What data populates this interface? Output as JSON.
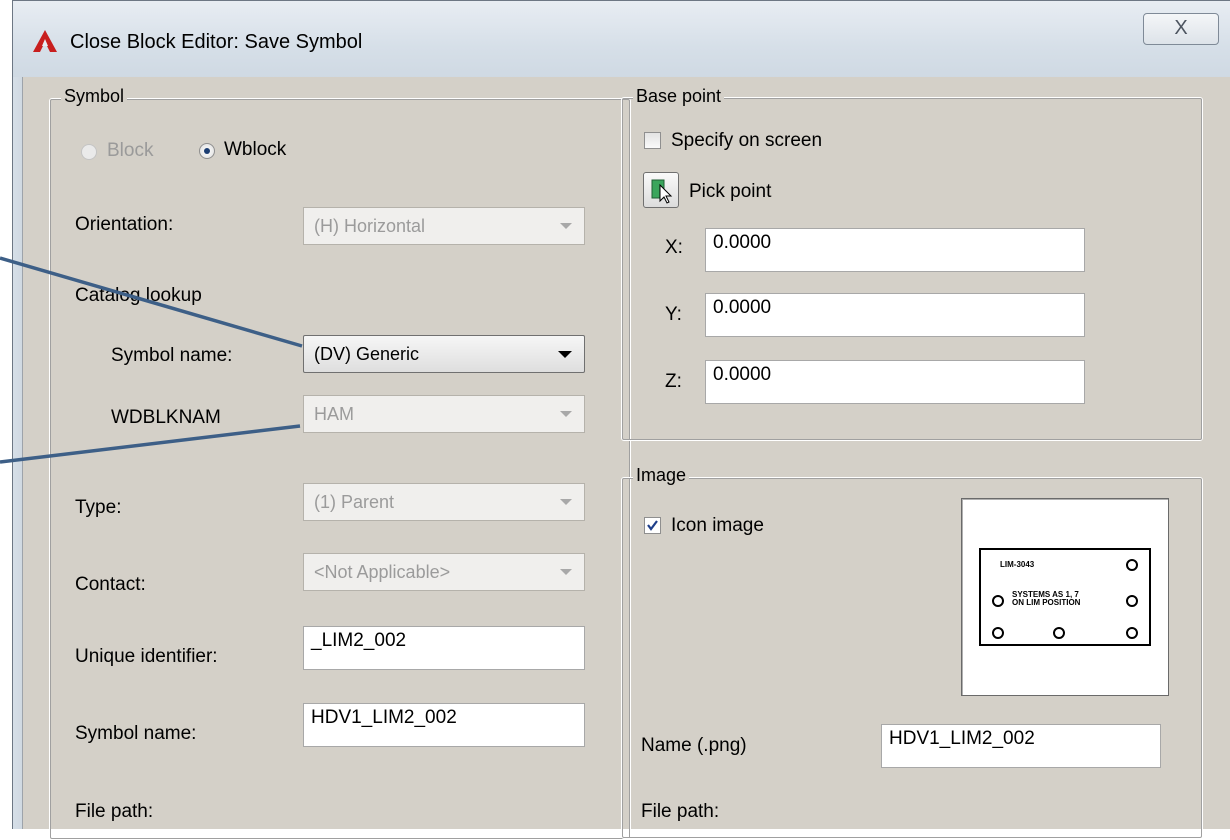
{
  "window": {
    "title": "Close Block Editor: Save Symbol",
    "close_glyph": "X"
  },
  "symbol_group": {
    "legend": "Symbol",
    "radio_block": "Block",
    "radio_wblock": "Wblock",
    "selected": "Wblock",
    "orientation_label": "Orientation:",
    "orientation_value": "(H) Horizontal",
    "catalog_lookup_label": "Catalog lookup",
    "symbol_name_combo_label": "Symbol name:",
    "symbol_name_combo_value": "(DV) Generic",
    "wdblknam_label": "WDBLKNAM",
    "wdblknam_value": "HAM",
    "type_label": "Type:",
    "type_value": "(1) Parent",
    "contact_label": "Contact:",
    "contact_value": "<Not Applicable>",
    "unique_id_label": "Unique identifier:",
    "unique_id_value": "_LIM2_002",
    "symbol_name_label": "Symbol name:",
    "symbol_name_value": "HDV1_LIM2_002",
    "file_path_label": "File path:"
  },
  "base_point_group": {
    "legend": "Base point",
    "specify_on_screen_label": "Specify on screen",
    "specify_on_screen_checked": false,
    "pick_point_label": "Pick point",
    "x_label": "X:",
    "x_value": "0.0000",
    "y_label": "Y:",
    "y_value": "0.0000",
    "z_label": "Z:",
    "z_value": "0.0000"
  },
  "image_group": {
    "legend": "Image",
    "icon_image_label": "Icon image",
    "icon_image_checked": true,
    "preview_text_1": "LIM-3043",
    "preview_text_2": "SYSTEMS AS 1, 7",
    "preview_text_3": "ON LIM POSITION",
    "png_name_label": "Name (.png)",
    "png_name_value": "HDV1_LIM2_002",
    "file_path_label": "File path:"
  },
  "colors": {
    "dialog_bg": "#d4d0c8",
    "callout_line": "#3d5f87",
    "app_icon": "#c81e1e"
  }
}
